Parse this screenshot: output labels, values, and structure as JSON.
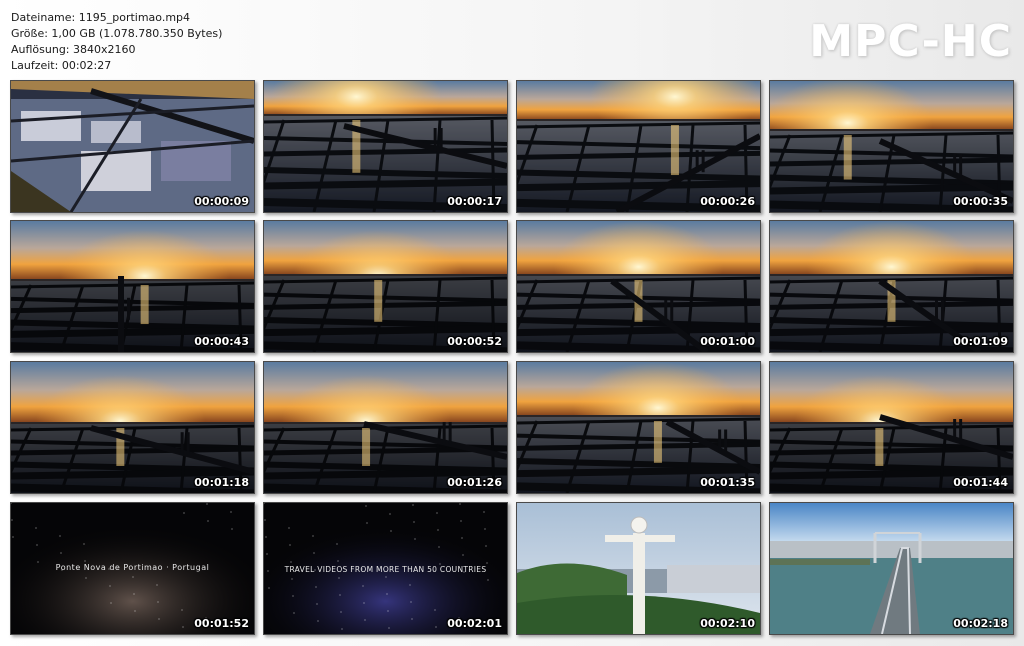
{
  "file_info": {
    "filename_line": "Dateiname: 1195_portimao.mp4",
    "size_line": "Größe: 1,00 GB (1.078.780.350 Bytes)",
    "resolution_line": "Auflösung: 3840x2160",
    "duration_line": "Laufzeit: 00:02:27"
  },
  "logo": "MPC-HC",
  "thumbnails": [
    {
      "time": "00:00:09"
    },
    {
      "time": "00:00:17"
    },
    {
      "time": "00:00:26"
    },
    {
      "time": "00:00:35"
    },
    {
      "time": "00:00:43"
    },
    {
      "time": "00:00:52"
    },
    {
      "time": "00:01:00"
    },
    {
      "time": "00:01:09"
    },
    {
      "time": "00:01:18"
    },
    {
      "time": "00:01:26"
    },
    {
      "time": "00:01:35"
    },
    {
      "time": "00:01:44"
    },
    {
      "time": "00:01:52",
      "caption": "Ponte Nova de Portimao · Portugal"
    },
    {
      "time": "00:02:01",
      "caption": "TRAVEL VIDEOS FROM MORE THAN 50 COUNTRIES"
    },
    {
      "time": "00:02:10"
    },
    {
      "time": "00:02:18"
    }
  ],
  "colors": {
    "sunset_sky_top": "#5b7da3",
    "sunset_horizon": "#f2a23a",
    "water_dark": "#1c2433",
    "timestamp_text": "#ffffff"
  }
}
